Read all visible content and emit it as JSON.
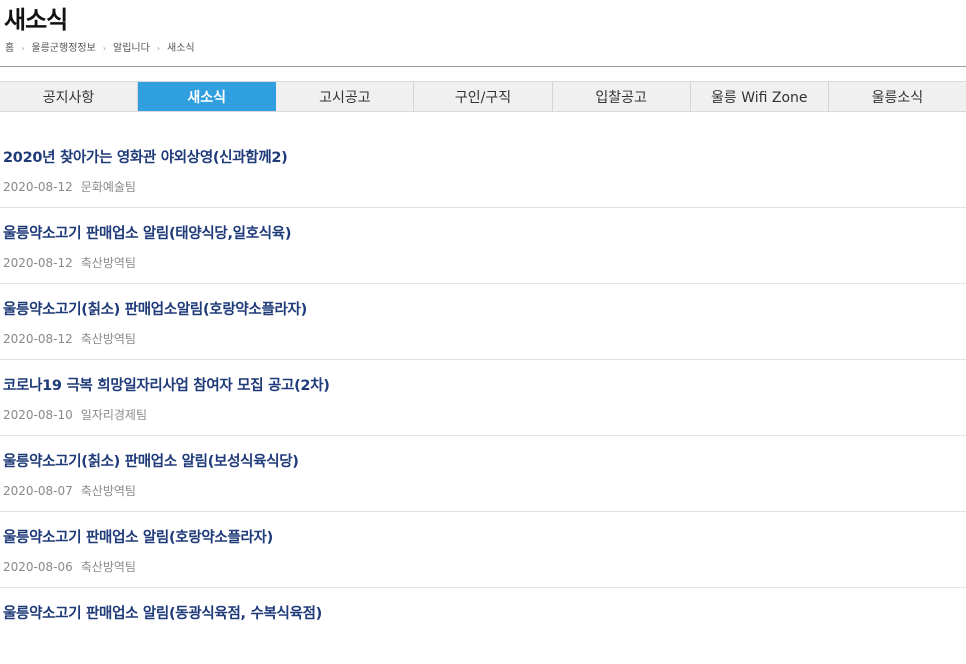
{
  "page": {
    "title": "새소식"
  },
  "breadcrumb": {
    "separator": "›",
    "items": [
      "홈",
      "울릉군행정정보",
      "알립니다",
      "새소식"
    ]
  },
  "tabs": [
    {
      "label": "공지사항",
      "active": false
    },
    {
      "label": "새소식",
      "active": true
    },
    {
      "label": "고시공고",
      "active": false
    },
    {
      "label": "구인/구직",
      "active": false
    },
    {
      "label": "입찰공고",
      "active": false
    },
    {
      "label": "울릉 Wifi Zone",
      "active": false
    },
    {
      "label": "울릉소식",
      "active": false
    }
  ],
  "news": [
    {
      "title": "2020년 찾아가는 영화관 야외상영(신과함께2)",
      "date": "2020-08-12",
      "dept": "문화예술팀"
    },
    {
      "title": "울릉약소고기 판매업소 알림(태양식당,일호식육)",
      "date": "2020-08-12",
      "dept": "축산방역팀"
    },
    {
      "title": "울릉약소고기(칡소) 판매업소알림(호랑약소플라자)",
      "date": "2020-08-12",
      "dept": "축산방역팀"
    },
    {
      "title": "코로나19 극복 희망일자리사업 참여자 모집 공고(2차)",
      "date": "2020-08-10",
      "dept": "일자리경제팀"
    },
    {
      "title": "울릉약소고기(칡소) 판매업소 알림(보성식육식당)",
      "date": "2020-08-07",
      "dept": "축산방역팀"
    },
    {
      "title": "울릉약소고기 판매업소 알림(호랑약소플라자)",
      "date": "2020-08-06",
      "dept": "축산방역팀"
    },
    {
      "title": "울릉약소고기 판매업소 알림(동광식육점, 수복식육점)",
      "date": "",
      "dept": ""
    }
  ],
  "colors": {
    "accent": "#2f9fe0",
    "title_link": "#1e3a78",
    "meta": "#8a8a8a"
  }
}
